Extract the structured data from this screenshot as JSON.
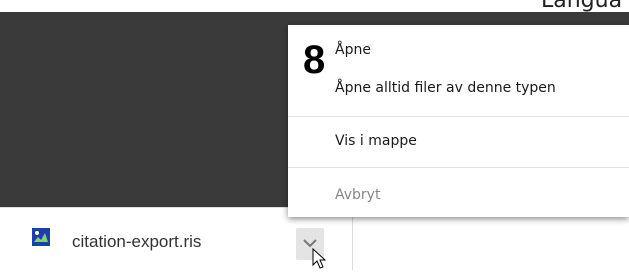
{
  "background_text": {
    "partial": "Langua"
  },
  "menu": {
    "step_number": "8",
    "items": [
      {
        "label": "Åpne"
      },
      {
        "label": "Åpne alltid filer av denne typen"
      },
      {
        "label": "Vis i mappe"
      },
      {
        "label": "Avbryt",
        "disabled": true
      }
    ]
  },
  "download": {
    "filename": "citation-export.ris",
    "icon": "ris-file-icon"
  }
}
